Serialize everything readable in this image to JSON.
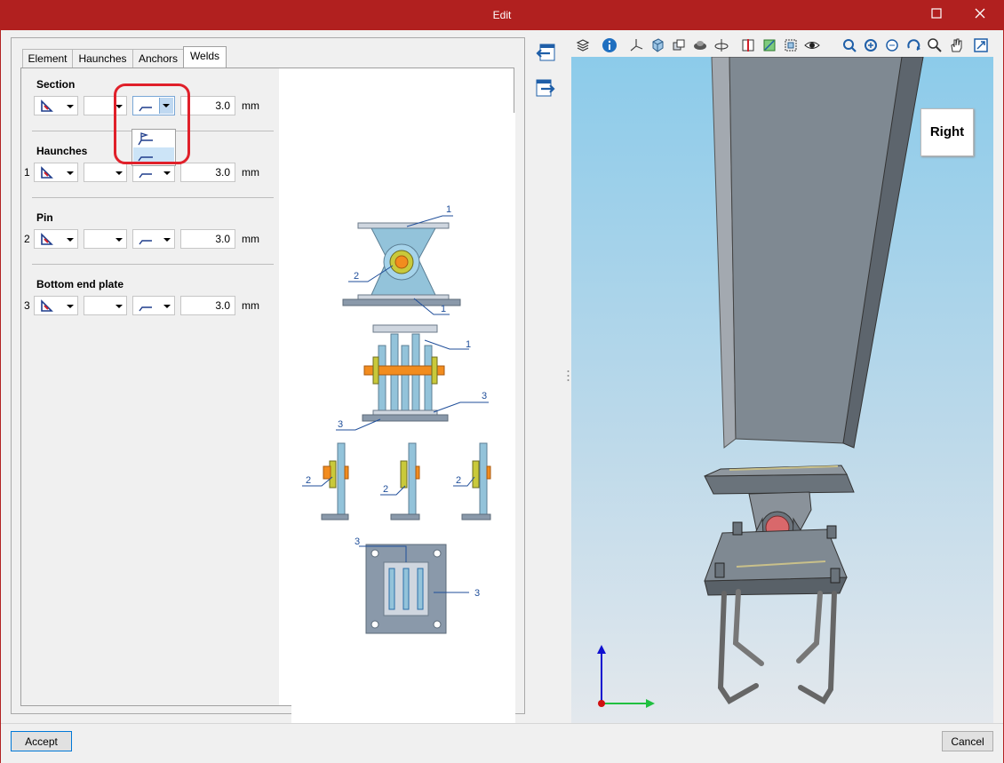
{
  "window": {
    "title": "Edit",
    "minimize_icon": "minimize-icon",
    "maximize_icon": "maximize-icon",
    "close_icon": "close-icon"
  },
  "tabs": [
    {
      "label": "Element"
    },
    {
      "label": "Haunches"
    },
    {
      "label": "Anchors"
    },
    {
      "label": "Welds"
    }
  ],
  "active_tab": "Welds",
  "sections": {
    "section": {
      "title": "Section",
      "number": "",
      "thickness": "3.0",
      "unit": "mm"
    },
    "haunches": {
      "title": "Haunches",
      "number": "1",
      "thickness": "3.0",
      "unit": "mm"
    },
    "pin": {
      "title": "Pin",
      "number": "2",
      "thickness": "3.0",
      "unit": "mm"
    },
    "bottom_end_plate": {
      "title": "Bottom end plate",
      "number": "3",
      "thickness": "3.0",
      "unit": "mm"
    }
  },
  "weld_type_options": [
    "weld-all-around-icon",
    "weld-fillet-icon"
  ],
  "weld_type_selected_index": 1,
  "diagram_labels": {
    "l1a": "1",
    "l2a": "2",
    "l1b": "1",
    "l1c": "1",
    "l3a": "3",
    "l3b": "3",
    "l2b": "2",
    "l2c": "2",
    "l2d": "2",
    "l3c": "3",
    "l3d": "3"
  },
  "viewer": {
    "view_cube_label": "Right"
  },
  "buttons": {
    "accept": "Accept",
    "cancel": "Cancel"
  },
  "colors": {
    "titlebar": "#b1201f",
    "highlight": "#e0202a",
    "sky_top": "#8ccbea",
    "steel": "#7f8992",
    "weld_line": "#1f4e9a"
  }
}
